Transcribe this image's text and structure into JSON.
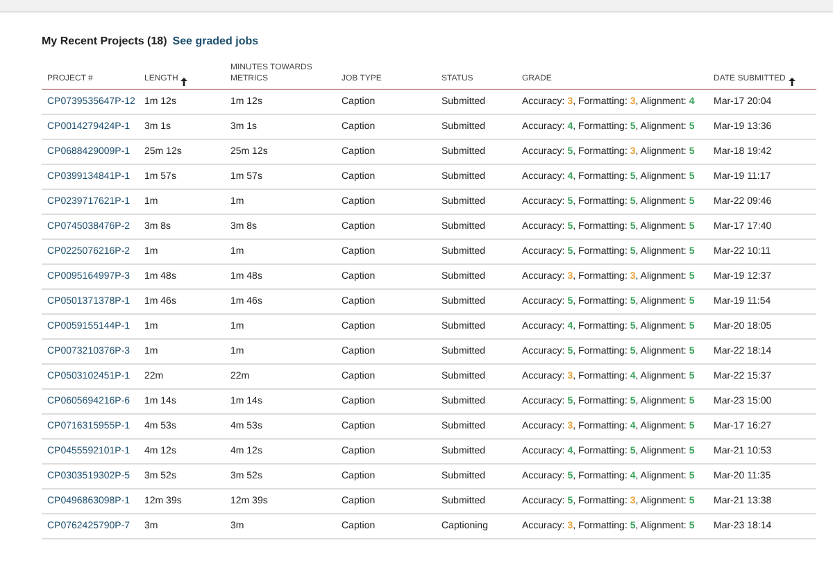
{
  "heading": {
    "title": "My Recent Projects (18)",
    "link": "See graded jobs"
  },
  "table": {
    "columns": [
      {
        "label": "PROJECT #",
        "sorted": false
      },
      {
        "label": "LENGTH",
        "sorted": true
      },
      {
        "label": "MINUTES TOWARDS METRICS",
        "sorted": false
      },
      {
        "label": "JOB TYPE",
        "sorted": false
      },
      {
        "label": "STATUS",
        "sorted": false
      },
      {
        "label": "GRADE",
        "sorted": false
      },
      {
        "label": "DATE SUBMITTED",
        "sorted": true
      }
    ],
    "rows": [
      {
        "project": "CP0739535647P-12",
        "length": "1m 12s",
        "minutes": "1m 12s",
        "job_type": "Caption",
        "status": "Submitted",
        "grades": [
          {
            "label": "Accuracy:",
            "score": "3",
            "suffix": ",",
            "color": "#e8a23a"
          },
          {
            "label": "Formatting:",
            "score": "3",
            "suffix": ",",
            "color": "#e8a23a"
          },
          {
            "label": "Alignment:",
            "score": "4",
            "color": "#3aa35a"
          }
        ],
        "date": "Mar-17 20:04"
      },
      {
        "project": "CP0014279424P-1",
        "length": "3m 1s",
        "minutes": "3m 1s",
        "job_type": "Caption",
        "status": "Submitted",
        "grades": [
          {
            "label": "Accuracy:",
            "score": "4",
            "suffix": ",",
            "color": "#3aa35a"
          },
          {
            "label": "Formatting:",
            "score": "5",
            "suffix": ",",
            "color": "#3aa35a"
          },
          {
            "label": "Alignment:",
            "score": "5",
            "color": "#3aa35a"
          }
        ],
        "date": "Mar-19 13:36"
      },
      {
        "project": "CP0688429009P-1",
        "length": "25m 12s",
        "minutes": "25m 12s",
        "job_type": "Caption",
        "status": "Submitted",
        "grades": [
          {
            "label": "Accuracy:",
            "score": "5",
            "suffix": ",",
            "color": "#3aa35a"
          },
          {
            "label": "Formatting:",
            "score": "3",
            "suffix": ",",
            "color": "#e8a23a"
          },
          {
            "label": "Alignment:",
            "score": "5",
            "color": "#3aa35a"
          }
        ],
        "date": "Mar-18 19:42"
      },
      {
        "project": "CP0399134841P-1",
        "length": "1m 57s",
        "minutes": "1m 57s",
        "job_type": "Caption",
        "status": "Submitted",
        "grades": [
          {
            "label": "Accuracy:",
            "score": "4",
            "suffix": ",",
            "color": "#3aa35a"
          },
          {
            "label": "Formatting:",
            "score": "5",
            "suffix": ",",
            "color": "#3aa35a"
          },
          {
            "label": "Alignment:",
            "score": "5",
            "color": "#3aa35a"
          }
        ],
        "date": "Mar-19 11:17"
      },
      {
        "project": "CP0239717621P-1",
        "length": "1m",
        "minutes": "1m",
        "job_type": "Caption",
        "status": "Submitted",
        "grades": [
          {
            "label": "Accuracy:",
            "score": "5",
            "suffix": ",",
            "color": "#3aa35a"
          },
          {
            "label": "Formatting:",
            "score": "5",
            "suffix": ",",
            "color": "#3aa35a"
          },
          {
            "label": "Alignment:",
            "score": "5",
            "color": "#3aa35a"
          }
        ],
        "date": "Mar-22 09:46"
      },
      {
        "project": "CP0745038476P-2",
        "length": "3m 8s",
        "minutes": "3m 8s",
        "job_type": "Caption",
        "status": "Submitted",
        "grades": [
          {
            "label": "Accuracy:",
            "score": "5",
            "suffix": ",",
            "color": "#3aa35a"
          },
          {
            "label": "Formatting:",
            "score": "5",
            "suffix": ",",
            "color": "#3aa35a"
          },
          {
            "label": "Alignment:",
            "score": "5",
            "color": "#3aa35a"
          }
        ],
        "date": "Mar-17 17:40"
      },
      {
        "project": "CP0225076216P-2",
        "length": "1m",
        "minutes": "1m",
        "job_type": "Caption",
        "status": "Submitted",
        "grades": [
          {
            "label": "Accuracy:",
            "score": "5",
            "suffix": ",",
            "color": "#3aa35a"
          },
          {
            "label": "Formatting:",
            "score": "5",
            "suffix": ",",
            "color": "#3aa35a"
          },
          {
            "label": "Alignment:",
            "score": "5",
            "color": "#3aa35a"
          }
        ],
        "date": "Mar-22 10:11"
      },
      {
        "project": "CP0095164997P-3",
        "length": "1m 48s",
        "minutes": "1m 48s",
        "job_type": "Caption",
        "status": "Submitted",
        "grades": [
          {
            "label": "Accuracy:",
            "score": "3",
            "suffix": ",",
            "color": "#e8a23a"
          },
          {
            "label": "Formatting:",
            "score": "3",
            "suffix": ",",
            "color": "#e8a23a"
          },
          {
            "label": "Alignment:",
            "score": "5",
            "color": "#3aa35a"
          }
        ],
        "date": "Mar-19 12:37"
      },
      {
        "project": "CP0501371378P-1",
        "length": "1m 46s",
        "minutes": "1m 46s",
        "job_type": "Caption",
        "status": "Submitted",
        "grades": [
          {
            "label": "Accuracy:",
            "score": "5",
            "suffix": ",",
            "color": "#3aa35a"
          },
          {
            "label": "Formatting:",
            "score": "5",
            "suffix": ",",
            "color": "#3aa35a"
          },
          {
            "label": "Alignment:",
            "score": "5",
            "color": "#3aa35a"
          }
        ],
        "date": "Mar-19 11:54"
      },
      {
        "project": "CP0059155144P-1",
        "length": "1m",
        "minutes": "1m",
        "job_type": "Caption",
        "status": "Submitted",
        "grades": [
          {
            "label": "Accuracy:",
            "score": "4",
            "suffix": ",",
            "color": "#3aa35a"
          },
          {
            "label": "Formatting:",
            "score": "5",
            "suffix": ",",
            "color": "#3aa35a"
          },
          {
            "label": "Alignment:",
            "score": "5",
            "color": "#3aa35a"
          }
        ],
        "date": "Mar-20 18:05"
      },
      {
        "project": "CP0073210376P-3",
        "length": "1m",
        "minutes": "1m",
        "job_type": "Caption",
        "status": "Submitted",
        "grades": [
          {
            "label": "Accuracy:",
            "score": "5",
            "suffix": ",",
            "color": "#3aa35a"
          },
          {
            "label": "Formatting:",
            "score": "5",
            "suffix": ",",
            "color": "#3aa35a"
          },
          {
            "label": "Alignment:",
            "score": "5",
            "color": "#3aa35a"
          }
        ],
        "date": "Mar-22 18:14"
      },
      {
        "project": "CP0503102451P-1",
        "length": "22m",
        "minutes": "22m",
        "job_type": "Caption",
        "status": "Submitted",
        "grades": [
          {
            "label": "Accuracy:",
            "score": "3",
            "suffix": ",",
            "color": "#e8a23a"
          },
          {
            "label": "Formatting:",
            "score": "4",
            "suffix": ",",
            "color": "#3aa35a"
          },
          {
            "label": "Alignment:",
            "score": "5",
            "color": "#3aa35a"
          }
        ],
        "date": "Mar-22 15:37"
      },
      {
        "project": "CP0605694216P-6",
        "length": "1m 14s",
        "minutes": "1m 14s",
        "job_type": "Caption",
        "status": "Submitted",
        "grades": [
          {
            "label": "Accuracy:",
            "score": "5",
            "suffix": ",",
            "color": "#3aa35a"
          },
          {
            "label": "Formatting:",
            "score": "5",
            "suffix": ",",
            "color": "#3aa35a"
          },
          {
            "label": "Alignment:",
            "score": "5",
            "color": "#3aa35a"
          }
        ],
        "date": "Mar-23 15:00"
      },
      {
        "project": "CP0716315955P-1",
        "length": "4m 53s",
        "minutes": "4m 53s",
        "job_type": "Caption",
        "status": "Submitted",
        "grades": [
          {
            "label": "Accuracy:",
            "score": "3",
            "suffix": ",",
            "color": "#e8a23a"
          },
          {
            "label": "Formatting:",
            "score": "4",
            "suffix": ",",
            "color": "#3aa35a"
          },
          {
            "label": "Alignment:",
            "score": "5",
            "color": "#3aa35a"
          }
        ],
        "date": "Mar-17 16:27"
      },
      {
        "project": "CP0455592101P-1",
        "length": "4m 12s",
        "minutes": "4m 12s",
        "job_type": "Caption",
        "status": "Submitted",
        "grades": [
          {
            "label": "Accuracy:",
            "score": "4",
            "suffix": ",",
            "color": "#3aa35a"
          },
          {
            "label": "Formatting:",
            "score": "5",
            "suffix": ",",
            "color": "#3aa35a"
          },
          {
            "label": "Alignment:",
            "score": "5",
            "color": "#3aa35a"
          }
        ],
        "date": "Mar-21 10:53"
      },
      {
        "project": "CP0303519302P-5",
        "length": "3m 52s",
        "minutes": "3m 52s",
        "job_type": "Caption",
        "status": "Submitted",
        "grades": [
          {
            "label": "Accuracy:",
            "score": "5",
            "suffix": ",",
            "color": "#3aa35a"
          },
          {
            "label": "Formatting:",
            "score": "4",
            "suffix": ",",
            "color": "#3aa35a"
          },
          {
            "label": "Alignment:",
            "score": "5",
            "color": "#3aa35a"
          }
        ],
        "date": "Mar-20 11:35"
      },
      {
        "project": "CP0496863098P-1",
        "length": "12m 39s",
        "minutes": "12m 39s",
        "job_type": "Caption",
        "status": "Submitted",
        "grades": [
          {
            "label": "Accuracy:",
            "score": "5",
            "suffix": ",",
            "color": "#3aa35a"
          },
          {
            "label": "Formatting:",
            "score": "3",
            "suffix": ",",
            "color": "#e8a23a"
          },
          {
            "label": "Alignment:",
            "score": "5",
            "color": "#3aa35a"
          }
        ],
        "date": "Mar-21 13:38"
      },
      {
        "project": "CP0762425790P-7",
        "length": "3m",
        "minutes": "3m",
        "job_type": "Caption",
        "status": "Captioning",
        "grades": [
          {
            "label": "Accuracy:",
            "score": "3",
            "suffix": ",",
            "color": "#e8a23a"
          },
          {
            "label": "Formatting:",
            "score": "5",
            "suffix": ",",
            "color": "#3aa35a"
          },
          {
            "label": "Alignment:",
            "score": "5",
            "color": "#3aa35a"
          }
        ],
        "date": "Mar-23 18:14"
      }
    ]
  }
}
